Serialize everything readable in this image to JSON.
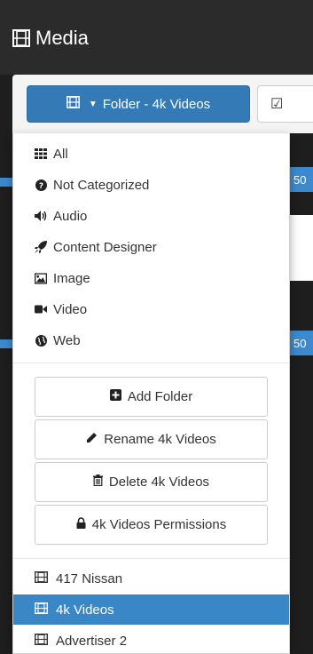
{
  "page": {
    "title": "Media"
  },
  "toolbar": {
    "folder_button_label": "Folder - 4k Videos"
  },
  "background": {
    "badge_1": "50",
    "badge_2": "50"
  },
  "menu": {
    "categories": [
      {
        "label": "All",
        "icon": "grid-icon"
      },
      {
        "label": "Not Categorized",
        "icon": "question-circle-icon"
      },
      {
        "label": "Audio",
        "icon": "volume-icon"
      },
      {
        "label": "Content Designer",
        "icon": "rocket-icon"
      },
      {
        "label": "Image",
        "icon": "picture-icon"
      },
      {
        "label": "Video",
        "icon": "video-camera-icon"
      },
      {
        "label": "Web",
        "icon": "globe-icon"
      }
    ],
    "actions": [
      {
        "label": "Add Folder",
        "icon": "plus-square-icon"
      },
      {
        "label": "Rename 4k Videos",
        "icon": "pencil-icon"
      },
      {
        "label": "Delete 4k Videos",
        "icon": "trash-icon"
      },
      {
        "label": "4k Videos Permissions",
        "icon": "lock-icon"
      }
    ],
    "folders": [
      {
        "label": "417 Nissan",
        "icon": "film-icon",
        "active": false
      },
      {
        "label": "4k Videos",
        "icon": "film-icon",
        "active": true
      },
      {
        "label": "Advertiser 2",
        "icon": "film-icon",
        "active": false
      }
    ]
  },
  "colors": {
    "primary": "#337ab7",
    "active_row": "#3a87c8",
    "header_bg": "#2b2b2b"
  }
}
